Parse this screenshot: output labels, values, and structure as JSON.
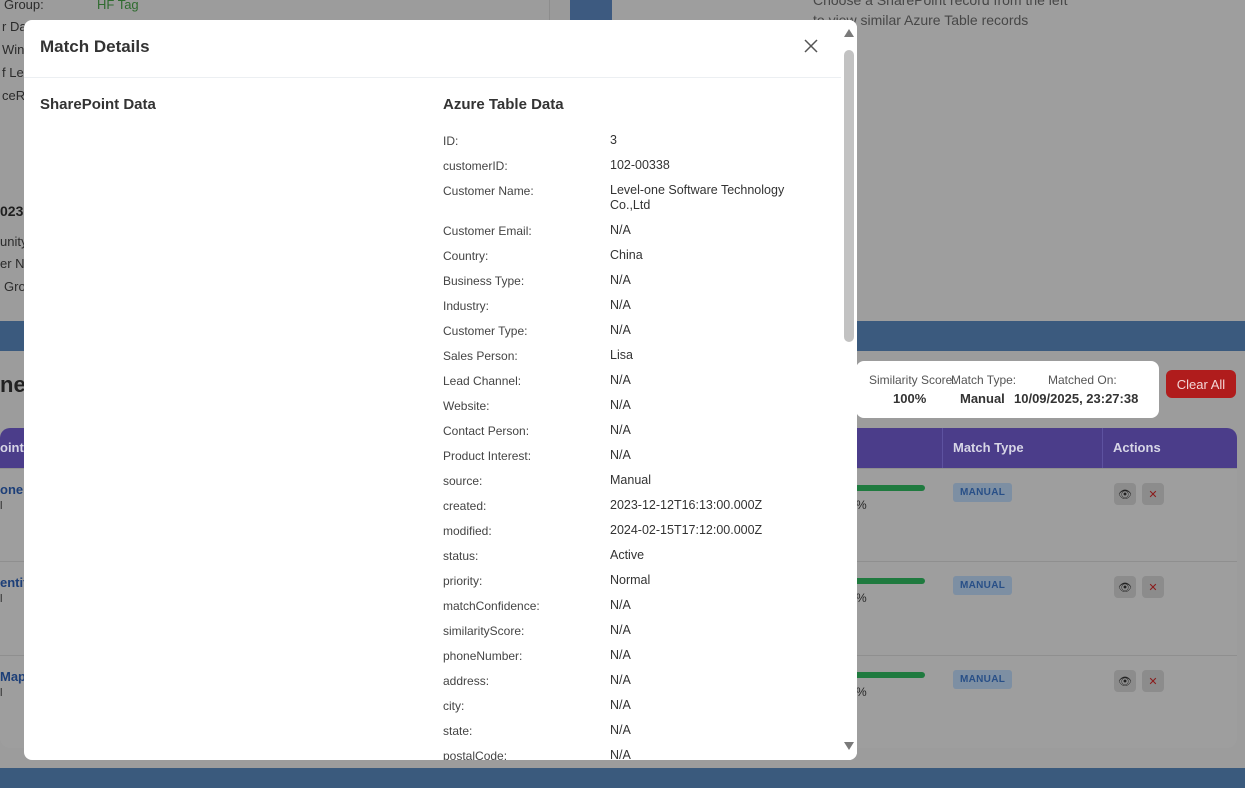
{
  "background": {
    "left_labels": [
      "Group:",
      "r Dat",
      "Win",
      "f Le",
      "ceR"
    ],
    "left_tag": "HF Tag",
    "left_section_year": "023",
    "left_section_labels": [
      "unity",
      "er N",
      "Gro"
    ],
    "right_hint": "Choose a SharePoint record from the left to view similar Azure Table records",
    "heading": "ned",
    "table": {
      "headers": [
        "oint I",
        "Match Type",
        "Actions"
      ],
      "rows": [
        {
          "link": "one S",
          "sub": "l",
          "pct": "%",
          "badge": "MANUAL"
        },
        {
          "link": "entif",
          "sub": "l",
          "pct": "%",
          "badge": "MANUAL"
        },
        {
          "link": "Map",
          "sub": "l",
          "pct": "%",
          "badge": "MANUAL"
        }
      ],
      "bar_colors": {
        "fill": "#2e9e52"
      }
    },
    "card": {
      "similarity_label": "Similarity Score:",
      "similarity_value": "100%",
      "match_type_label": "Match Type:",
      "match_type_value": "Manual",
      "matched_on_label": "Matched On:",
      "matched_on_value": "10/09/2025, 23:27:38"
    },
    "clear_all": "Clear All"
  },
  "modal": {
    "title": "Match Details",
    "left_title": "SharePoint Data",
    "right_title": "Azure Table Data",
    "fields": [
      {
        "label": "ID:",
        "value": "3"
      },
      {
        "label": "customerID:",
        "value": "102-00338"
      },
      {
        "label": "Customer Name:",
        "value": "Level-one Software Technology Co.,Ltd"
      },
      {
        "label": "Customer Email:",
        "value": "N/A"
      },
      {
        "label": "Country:",
        "value": "China"
      },
      {
        "label": "Business Type:",
        "value": "N/A"
      },
      {
        "label": "Industry:",
        "value": "N/A"
      },
      {
        "label": "Customer Type:",
        "value": "N/A"
      },
      {
        "label": "Sales Person:",
        "value": "Lisa"
      },
      {
        "label": "Lead Channel:",
        "value": "N/A"
      },
      {
        "label": "Website:",
        "value": "N/A"
      },
      {
        "label": "Contact Person:",
        "value": "N/A"
      },
      {
        "label": "Product Interest:",
        "value": "N/A"
      },
      {
        "label": "source:",
        "value": "Manual"
      },
      {
        "label": "created:",
        "value": "2023-12-12T16:13:00.000Z"
      },
      {
        "label": "modified:",
        "value": "2024-02-15T17:12:00.000Z"
      },
      {
        "label": "status:",
        "value": "Active"
      },
      {
        "label": "priority:",
        "value": "Normal"
      },
      {
        "label": "matchConfidence:",
        "value": "N/A"
      },
      {
        "label": "similarityScore:",
        "value": "N/A"
      },
      {
        "label": "phoneNumber:",
        "value": "N/A"
      },
      {
        "label": "address:",
        "value": "N/A"
      },
      {
        "label": "city:",
        "value": "N/A"
      },
      {
        "label": "state:",
        "value": "N/A"
      },
      {
        "label": "postalCode:",
        "value": "N/A"
      }
    ]
  }
}
